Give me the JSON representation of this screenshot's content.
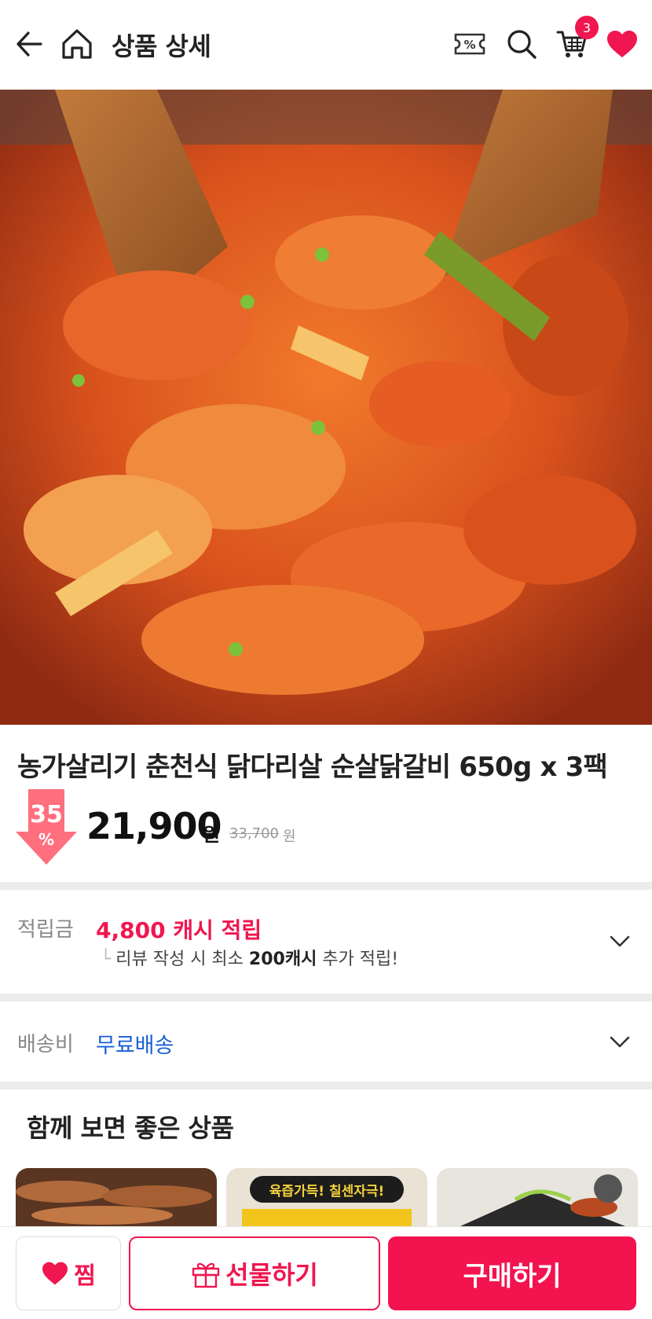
{
  "header": {
    "title": "상품 상세",
    "cart_count": "3",
    "coupon_icon_text": "%"
  },
  "product": {
    "name": "농가살리기 춘천식 닭다리살 순살닭갈비 650g x 3팩",
    "discount_rate": "35",
    "discount_symbol": "%",
    "price": "21,900",
    "price_unit": "원",
    "original_price": "33,700",
    "original_unit": "원"
  },
  "cash": {
    "label": "적립금",
    "value": "4,800 캐시 적립",
    "sub_corner": "└",
    "sub_prefix": "리뷰 작성 시 최소",
    "sub_bold": "200캐시",
    "sub_suffix": "추가 적립!"
  },
  "shipping": {
    "label": "배송비",
    "value": "무료배송"
  },
  "recommend": {
    "title": "함께 보면 좋은 상품",
    "thumb2_text": "육즙가득! 칠센자극!"
  },
  "bottom_bar": {
    "wish_label": "찜",
    "gift_label": "선물하기",
    "buy_label": "구매하기"
  },
  "colors": {
    "accent": "#f0164f",
    "link_blue": "#1a5fd6"
  }
}
